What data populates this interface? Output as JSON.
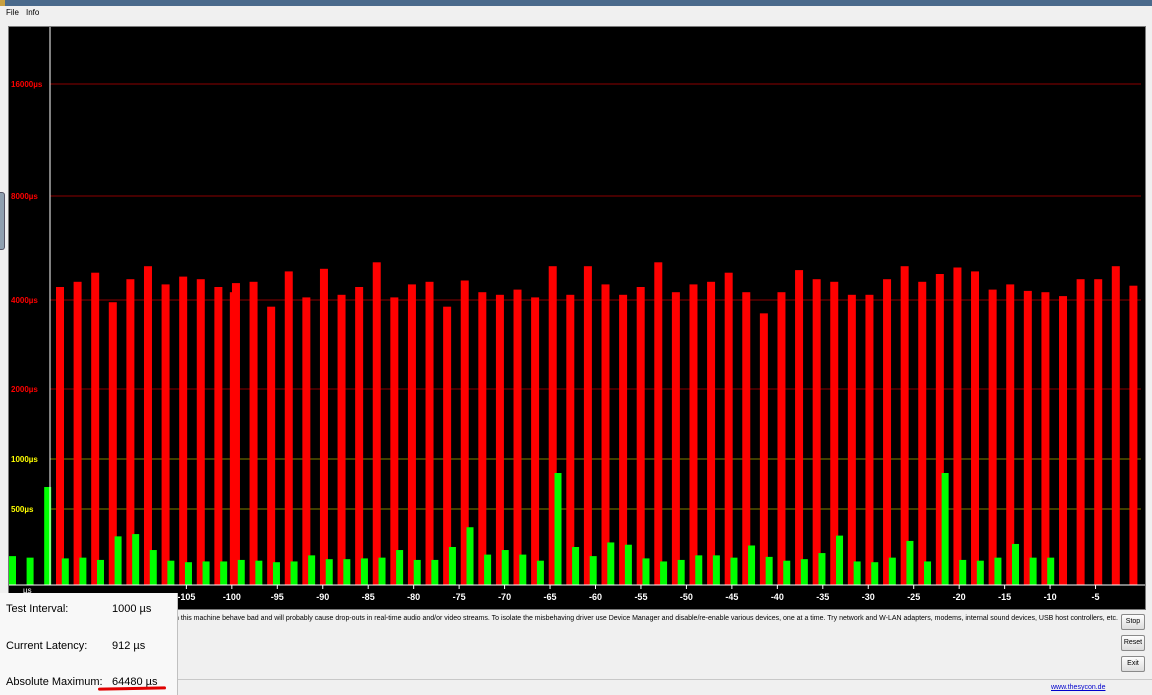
{
  "menu": {
    "file": "File",
    "info": "Info"
  },
  "chart_data": {
    "type": "bar",
    "y_ticks": [
      {
        "value": 500,
        "label": "500µs"
      },
      {
        "value": 1000,
        "label": "1000µs"
      },
      {
        "value": 2000,
        "label": "2000µs"
      },
      {
        "value": 4000,
        "label": "4000µs"
      },
      {
        "value": 8000,
        "label": "8000µs"
      },
      {
        "value": 16000,
        "label": "16000µs"
      }
    ],
    "y_unit_label": "µs",
    "x_ticks": [
      -105,
      -100,
      -95,
      -90,
      -85,
      -80,
      -75,
      -70,
      -65,
      -60,
      -55,
      -50,
      -45,
      -40,
      -35,
      -30,
      -25,
      -20,
      -15,
      -10,
      -5
    ],
    "x_range": [
      -120,
      0
    ],
    "highlight_x": -100,
    "colors": {
      "red": "#ff0000",
      "green": "#00ff00",
      "background": "#000000",
      "axis": "#ffffff",
      "tick_label": "#ff0000",
      "grid_red": "#8b0000",
      "grid_yellow": "#808000"
    },
    "green_series_values_us": [
      190,
      180,
      720,
      175,
      180,
      165,
      320,
      335,
      230,
      160,
      150,
      155,
      155,
      165,
      160,
      150,
      155,
      195,
      170,
      170,
      175,
      180,
      230,
      165,
      165,
      250,
      380,
      200,
      230,
      200,
      160,
      860,
      250,
      190,
      280,
      265,
      175,
      155,
      165,
      195,
      195,
      180,
      260,
      185,
      160,
      170,
      210,
      325,
      155,
      150,
      180,
      290,
      155,
      860,
      165,
      160,
      180,
      270,
      180,
      180
    ],
    "red_series_values_us": [
      4500,
      4700,
      5050,
      3950,
      4800,
      5300,
      4600,
      4900,
      4800,
      4500,
      4650,
      4700,
      3850,
      5100,
      4100,
      5200,
      4200,
      4500,
      5450,
      4100,
      4600,
      4700,
      3850,
      4750,
      4300,
      4200,
      4400,
      4100,
      5300,
      4200,
      5300,
      4600,
      4200,
      4500,
      5450,
      4300,
      4600,
      4700,
      5050,
      4300,
      3700,
      4300,
      5150,
      4800,
      4700,
      4200,
      4200,
      4800,
      5300,
      4700,
      5000,
      5250,
      5100,
      4400,
      4600,
      4350,
      4300,
      4150,
      4800,
      4800,
      5300,
      4550
    ]
  },
  "message": "n this machine behave bad and will probably cause drop-outs in real-time audio and/or video streams. To isolate the misbehaving driver use Device Manager and disable/re-enable various devices, one at a time. Try network and W-LAN adapters, modems, internal sound devices, USB host controllers, etc.",
  "info": {
    "test_interval_label": "Test Interval:",
    "test_interval_value": "1000 µs",
    "current_latency_label": "Current Latency:",
    "current_latency_value": "912 µs",
    "absolute_max_label": "Absolute Maximum:",
    "absolute_max_value": "64480 µs"
  },
  "buttons": {
    "stop": "Stop",
    "reset": "Reset",
    "exit": "Exit"
  },
  "link": "www.thesycon.de"
}
